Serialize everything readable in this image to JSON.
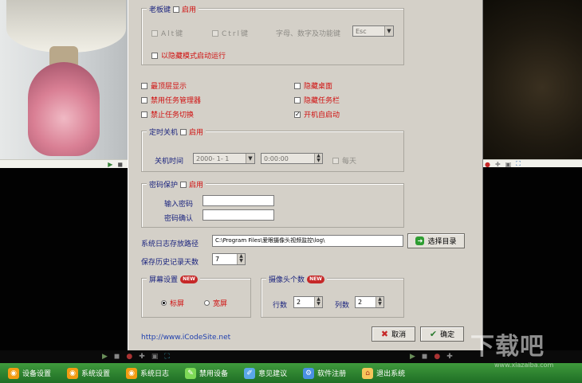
{
  "hotkey": {
    "title": "老板键",
    "enable": "启用",
    "alt": "Alt键",
    "ctrl": "Ctrl键",
    "key_hint": "字母、数字及功能键",
    "key_value": "Esc",
    "hidden_start": "以隐藏模式启动运行"
  },
  "options": {
    "top_display": "最顶层显示",
    "hide_desktop": "隐藏桌面",
    "disable_task_manager": "禁用任务管理器",
    "hide_taskbar": "隐藏任务栏",
    "disable_task_switch": "禁止任务切换",
    "autostart": "开机自启动"
  },
  "timer": {
    "title": "定时关机",
    "enable": "启用",
    "label": "关机时间",
    "date": "2000- 1- 1",
    "time": "0:00:00",
    "daily": "每天"
  },
  "password": {
    "title": "密码保护",
    "enable": "启用",
    "input_label": "输入密码",
    "confirm_label": "密码确认"
  },
  "log": {
    "path_label": "系统日志存放路径",
    "path_value": "C:\\Program Files\\爱眼摄像头视频监控\\log\\",
    "choose_button": "选择目录",
    "history_label": "保存历史记录天数",
    "history_days": "7"
  },
  "screen": {
    "title": "屏幕设置",
    "normal": "标屏",
    "wide": "宽屏",
    "badge": "NEW"
  },
  "cameras": {
    "title": "摄像头个数",
    "rows_label": "行数",
    "rows": "2",
    "cols_label": "列数",
    "cols": "2",
    "badge": "NEW"
  },
  "footer": {
    "link": "http://www.iCodeSite.net",
    "cancel": "取消",
    "ok": "确定"
  },
  "taskbar": {
    "items": [
      "设备设置",
      "系统设置",
      "系统日志",
      "禁用设备",
      "意见建议",
      "软件注册",
      "退出系统"
    ]
  },
  "watermark": {
    "big": "下载吧",
    "url": "www.xiazaiba.com"
  }
}
